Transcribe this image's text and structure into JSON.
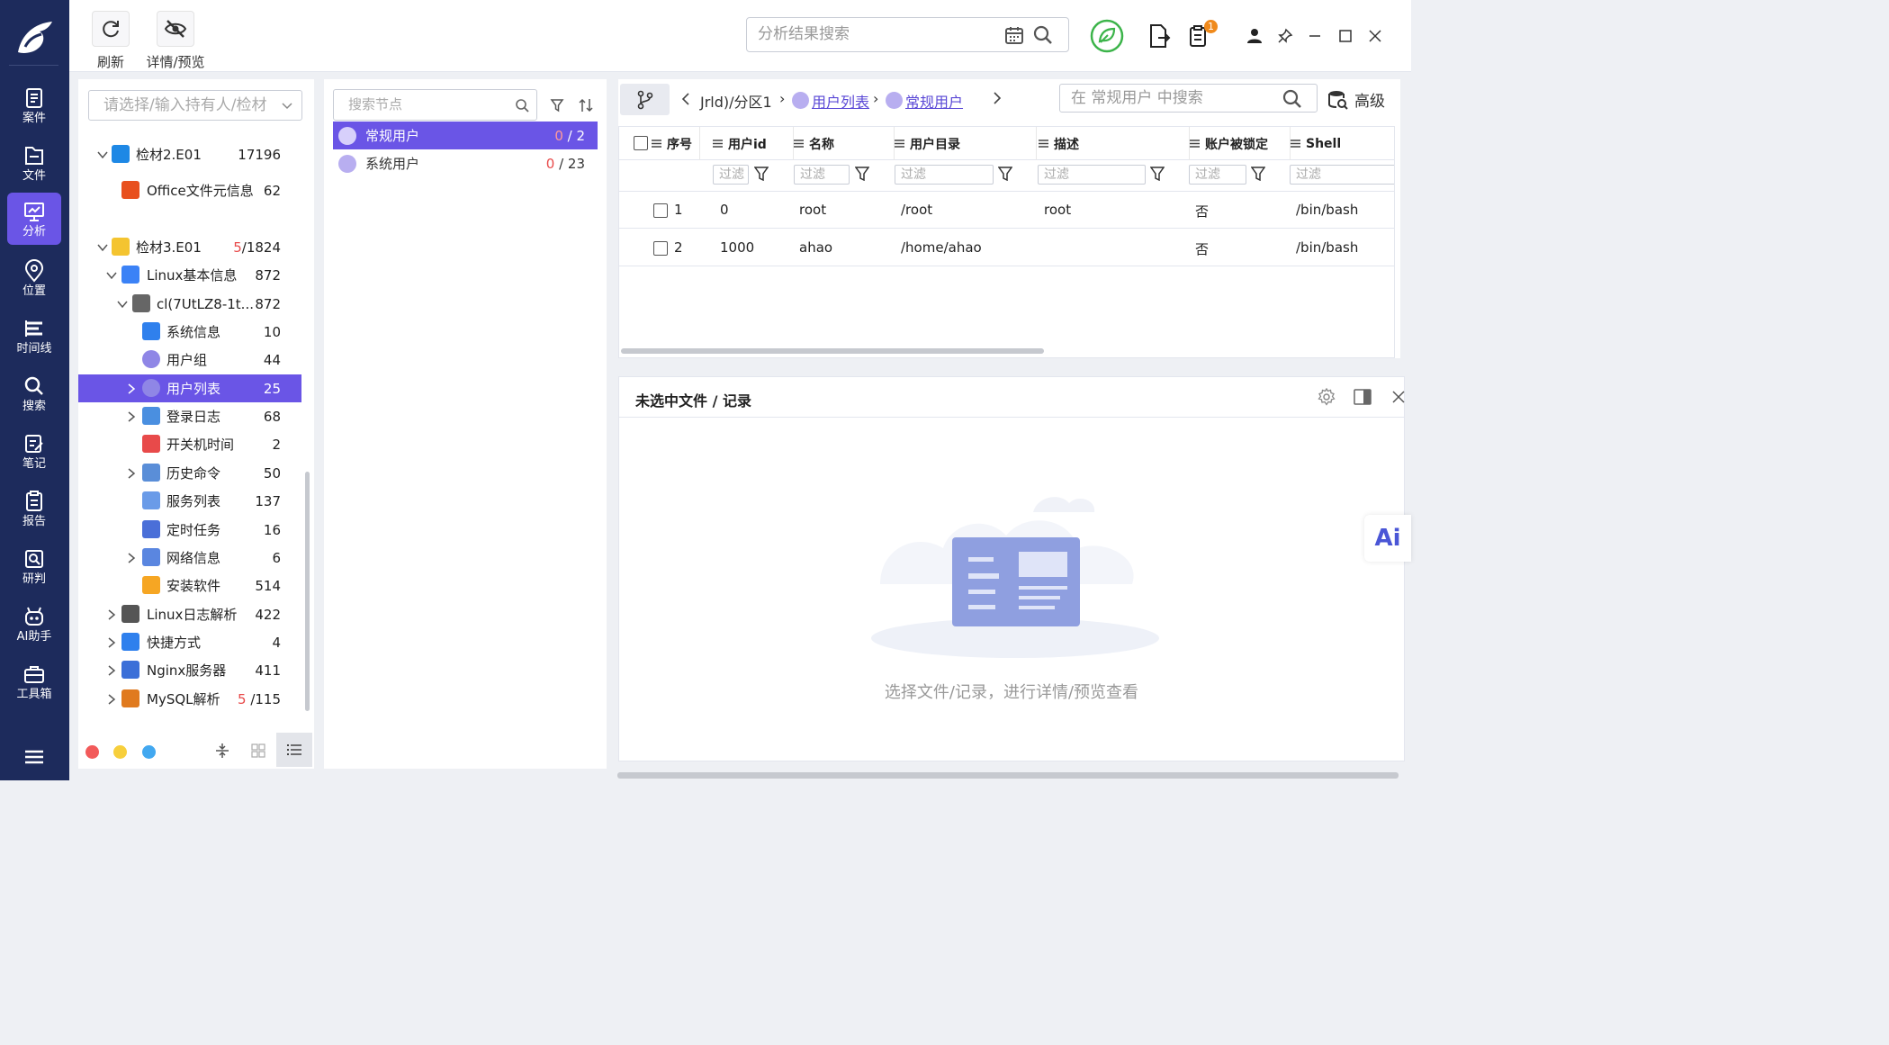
{
  "toolbar": {
    "refresh_label": "刷新",
    "detail_preview_label": "详情/预览",
    "search_placeholder": "分析结果搜索",
    "notification_count": "1"
  },
  "nav": {
    "items": [
      {
        "label": "案件",
        "icon": "case-icon"
      },
      {
        "label": "文件",
        "icon": "file-icon"
      },
      {
        "label": "分析",
        "icon": "analysis-icon",
        "active": true
      },
      {
        "label": "位置",
        "icon": "location-icon"
      },
      {
        "label": "时间线",
        "icon": "timeline-icon"
      },
      {
        "label": "搜索",
        "icon": "search-icon"
      },
      {
        "label": "笔记",
        "icon": "notes-icon"
      },
      {
        "label": "报告",
        "icon": "report-icon"
      },
      {
        "label": "研判",
        "icon": "judge-icon"
      },
      {
        "label": "AI助手",
        "icon": "ai-assistant-icon"
      },
      {
        "label": "工具箱",
        "icon": "toolbox-icon"
      }
    ]
  },
  "tree": {
    "select_placeholder": "请选择/输入持有人/检材",
    "rows": [
      {
        "label": "检材2.E01",
        "count": "17196",
        "icon": "windows-icon",
        "expanded": true
      },
      {
        "label": "Office文件元信息",
        "count": "62",
        "icon": "office-icon"
      },
      {
        "label": "检材3.E01",
        "count_red": "5",
        "count": "/1824",
        "icon": "linux-icon",
        "expanded": true
      },
      {
        "label": "Linux基本信息",
        "count": "872",
        "icon": "list-icon",
        "expanded": true
      },
      {
        "label": "cl(7UtLZ8-1t...",
        "count": "872",
        "icon": "disk-icon",
        "expanded": true
      },
      {
        "label": "系统信息",
        "count": "10",
        "icon": "sysinfo-icon"
      },
      {
        "label": "用户组",
        "count": "44",
        "icon": "usergroup-icon"
      },
      {
        "label": "用户列表",
        "count": "25",
        "icon": "userlist-icon",
        "selected": true
      },
      {
        "label": "登录日志",
        "count": "68",
        "icon": "login-log-icon"
      },
      {
        "label": "开关机时间",
        "count": "2",
        "icon": "power-icon"
      },
      {
        "label": "历史命令",
        "count": "50",
        "icon": "terminal-icon"
      },
      {
        "label": "服务列表",
        "count": "137",
        "icon": "service-icon"
      },
      {
        "label": "定时任务",
        "count": "16",
        "icon": "hourglass-icon"
      },
      {
        "label": "网络信息",
        "count": "6",
        "icon": "network-icon"
      },
      {
        "label": "安装软件",
        "count": "514",
        "icon": "package-icon"
      },
      {
        "label": "Linux日志解析",
        "count": "422",
        "icon": "log-icon"
      },
      {
        "label": "快捷方式",
        "count": "4",
        "icon": "shortcut-icon"
      },
      {
        "label": "Nginx服务器",
        "count": "411",
        "icon": "server-icon"
      },
      {
        "label": "MySQL解析",
        "count_red": "5",
        "count": " /115",
        "icon": "mysql-icon"
      }
    ]
  },
  "nodes": {
    "search_placeholder": "搜索节点",
    "items": [
      {
        "label": "常规用户",
        "red": "0",
        "total": " / 2",
        "selected": true
      },
      {
        "label": "系统用户",
        "red": "0",
        "total": " / 23"
      }
    ]
  },
  "breadcrumb": {
    "part1": "Jrld)/分区1",
    "part2": "用户列表",
    "part3": "常规用户",
    "search_placeholder": "在 常规用户 中搜索",
    "advanced_label": "高级"
  },
  "table": {
    "columns": [
      "序号",
      "用户id",
      "名称",
      "用户目录",
      "描述",
      "账户被锁定",
      "Shell"
    ],
    "filter_placeholder": "过滤",
    "rows": [
      [
        "1",
        "0",
        "root",
        "/root",
        "root",
        "否",
        "/bin/bash"
      ],
      [
        "2",
        "1000",
        "ahao",
        "/home/ahao",
        "",
        "否",
        "/bin/bash"
      ]
    ]
  },
  "detail": {
    "title": "未选中文件 / 记录",
    "empty_message": "选择文件/记录，进行详情/预览查看"
  },
  "ai_badge": "Ai",
  "colors": {
    "nav_bg": "#1d2b5c",
    "accent": "#6a55e6",
    "red": "#e84a4a",
    "green": "#3cb44a"
  }
}
